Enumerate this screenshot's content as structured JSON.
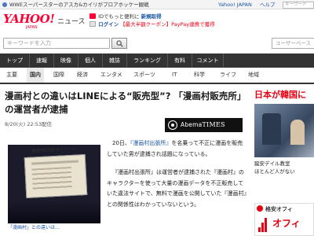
{
  "topbar": {
    "promo": "WWEスーパースターのアスカ&カイリがプロアホッケー観戦",
    "yahoo_japan": "Yahoo! JAPAN",
    "help": "ヘルプ",
    "search_placeholder": "キーワード"
  },
  "header": {
    "logo": "YAHOO!",
    "logo_sub": "JAPAN",
    "news": "ニュース",
    "line1_prefix": "IDでもっと便利に",
    "line1_link": "新規取得",
    "login": "ログイン",
    "bag_text": "【最大半額クーポン】PayPay連携で獲得"
  },
  "search": {
    "placeholder": "キーワードを入力",
    "user_search_placeholder": "ユーザーベース"
  },
  "nav": {
    "items": [
      "トップ",
      "速報",
      "映像",
      "個人",
      "雑誌",
      "ランキング",
      "有料",
      "コメント"
    ]
  },
  "subnav": {
    "items": [
      "主要",
      "国内",
      "国際",
      "経済",
      "エンタメ",
      "スポーツ",
      "IT",
      "科学",
      "ライフ",
      "地域"
    ],
    "active": "国内"
  },
  "article": {
    "title": "漫画村との違いはLINEによる“販売型”? 「漫画村販売所」の運営者が逮捕",
    "date": "8/20(火) 22:53配信",
    "source_name": "Abema",
    "source_times": "TIMES",
    "image_caption": "「漫画村」との違いは…",
    "image_overlay": "漫画村販売所 のイメージ",
    "p1_pre": "20日、",
    "p1_link": "『漫画村出張所』",
    "p1_post": "を名乗って不正に漫画を販売していた男が逮捕され話題になっている。",
    "p2": "『漫画村出張所』は運営者が逮捕された『漫画村』のキャラクターを使って大量の漫画データを不正販売していた違法サイトで、無料で漫画を公開していた『漫画村』との関係性はわかっていないという。"
  },
  "sidebar": {
    "ad_head": "日本が韓国に",
    "ad_caption_1": "蹴安デイル教室",
    "ad_caption_2": "ほとんど人がない",
    "ad2_top": "格安オフィ",
    "ad2_main": "オフィ"
  },
  "colors": {
    "brand_red": "#ff0033",
    "link_blue": "#1a55a6",
    "nav_dark": "#333333"
  }
}
